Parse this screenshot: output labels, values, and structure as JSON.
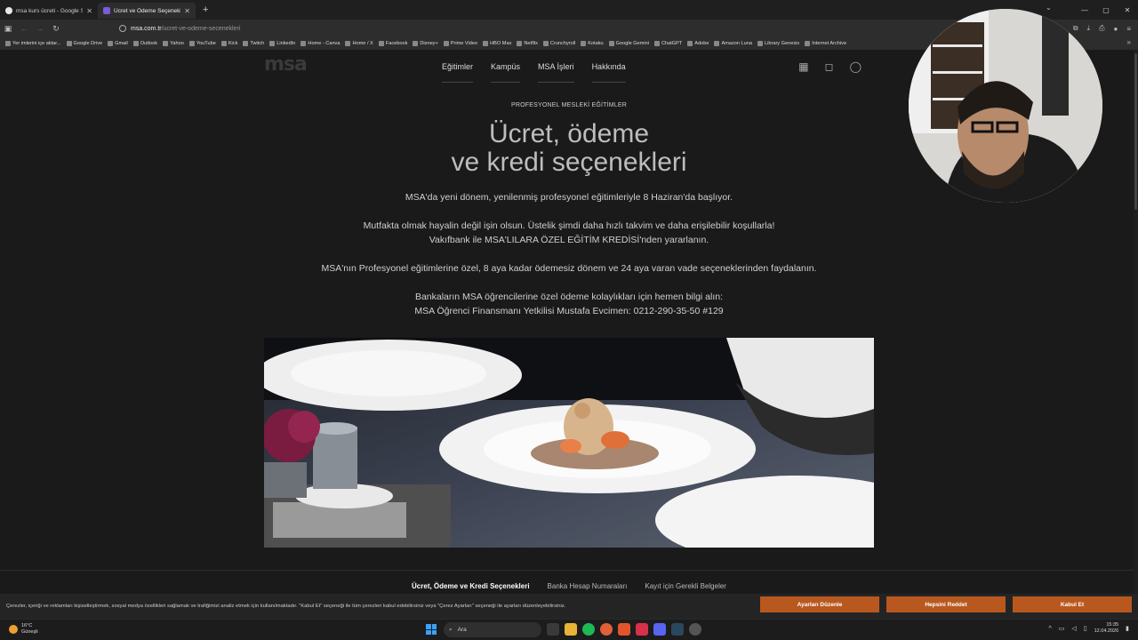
{
  "tabs": [
    {
      "title": "msa kurs ücreti - Google Search",
      "active": false
    },
    {
      "title": "Ücret ve Ödeme Seçenekleri | M",
      "active": true
    }
  ],
  "address": {
    "host": "msa.com.tr",
    "path": "/ucret-ve-odeme-secenekleri"
  },
  "bookmarks": [
    "Yer imlerini içe aktar...",
    "Google Drive",
    "Gmail",
    "Outlook",
    "Yahoo",
    "YouTube",
    "Kick",
    "Twitch",
    "LinkedIn",
    "Home - Canva",
    "Home / X",
    "Facebook",
    "Disney+",
    "Prime Video",
    "HBO Max",
    "Netflix",
    "Crunchyroll",
    "Kotaku",
    "Google Gemini",
    "ChatGPT",
    "Adobe",
    "Amazon Luna",
    "Library Genesis",
    "Internet Archive"
  ],
  "site": {
    "logo": "msa",
    "menu": [
      "Eğitimler",
      "Kampüs",
      "MSA İşleri",
      "Hakkında"
    ],
    "eyebrow": "PROFESYONEL MESLEKİ EĞİTİMLER",
    "headline_1": "Ücret, ödeme",
    "headline_2": "ve kredi seçenekleri",
    "p1": "MSA'da yeni dönem, yenilenmiş profesyonel eğitimleriyle 8 Haziran'da başlıyor.",
    "p2a": "Mutfakta olmak hayalin değil işin olsun. Üstelik şimdi daha hızlı takvim ve daha erişilebilir koşullarla!",
    "p2b": "Vakıfbank ile MSA'LILARA ÖZEL EĞİTİM KREDİSİ'nden yararlanın.",
    "p3": "MSA'nın Profesyonel eğitimlerine özel, 8 aya kadar ödemesiz dönem ve 24 aya varan vade seçeneklerinden faydalanın.",
    "p4a": "Bankaların MSA öğrencilerine özel ödeme kolaylıkları için hemen bilgi alın:",
    "p4b": "MSA Öğrenci Finansmanı Yetkilisi Mustafa Evcimen: 0212-290-35-50 #129",
    "subnav": [
      "Ücret, Ödeme ve Kredi Seçenekleri",
      "Banka Hesap Numaraları",
      "Kayıt için Gerekli Belgeler"
    ]
  },
  "cookie": {
    "text": "Çerezler, içeriği ve reklamları kişiselleştirmek, sosyal medya özellikleri sağlamak ve trafiğimizi analiz etmek için kullanılmaktadır. \"Kabul Et\" seçeneği ile tüm çerezleri kabul edebilirsiniz veya \"Çerez Ayarları\" seçeneği ile ayarları düzenleyebilirsiniz.",
    "settings": "Ayarları Düzenle",
    "reject": "Hepsini Reddet",
    "accept": "Kabul Et"
  },
  "taskbar": {
    "temp": "16°C",
    "weather": "Güneşli",
    "search": "Ara",
    "time": "15:35",
    "date": "12.04.2026"
  },
  "colors": {
    "accent": "#b8581f",
    "page_bg": "#1a1a1a"
  }
}
